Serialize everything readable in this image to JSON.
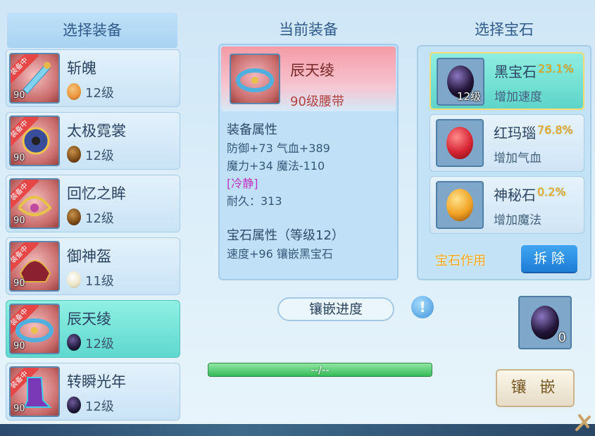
{
  "headers": {
    "left": "选择装备",
    "center": "当前装备",
    "right": "选择宝石"
  },
  "equipment": [
    {
      "equipped_tag": "装备中",
      "level": "90",
      "name": "斩魄",
      "gem_level": "12级",
      "gem_color": "#e8953a"
    },
    {
      "equipped_tag": "装备中",
      "level": "90",
      "name": "太极霓裳",
      "gem_level": "12级",
      "gem_color": "#7a4a16"
    },
    {
      "equipped_tag": "装备中",
      "level": "90",
      "name": "回忆之眸",
      "gem_level": "12级",
      "gem_color": "#7a4a16"
    },
    {
      "equipped_tag": "装备中",
      "level": "90",
      "name": "御神盔",
      "gem_level": "11级",
      "gem_color": "#e9e4c6"
    },
    {
      "equipped_tag": "装备中",
      "level": "90",
      "name": "辰天绫",
      "gem_level": "12级",
      "gem_color": "#1e1a3a"
    },
    {
      "equipped_tag": "装备中",
      "level": "90",
      "name": "转瞬光年",
      "gem_level": "12级",
      "gem_color": "#1e1a3a"
    }
  ],
  "selected_equipment_index": 4,
  "current": {
    "name": "辰天绫",
    "type": "90级腰带",
    "attr_title": "装备属性",
    "attr_line1": "防御+73 气血+389",
    "attr_line2": "魔力+34 魔法-110",
    "special": "[冷静]",
    "durability": "耐久：313",
    "gem_title": "宝石属性（等级12）",
    "gem_line": "速度+96 镶嵌黑宝石"
  },
  "gems": [
    {
      "name": "黑宝石",
      "rate": "23.1%",
      "desc": "增加速度",
      "count": "12级",
      "color": "#23163a",
      "selected": true
    },
    {
      "name": "红玛瑙",
      "rate": "76.8%",
      "desc": "增加气血",
      "count": "",
      "color": "#d62433",
      "selected": false
    },
    {
      "name": "神秘石",
      "rate": "0.2%",
      "desc": "增加魔法",
      "count": "",
      "color": "#f0a123",
      "selected": false
    }
  ],
  "gem_effect_label": "宝石作用",
  "remove_button": "拆 除",
  "inlay_progress_title": "镶嵌进度",
  "info_icon": "!",
  "progress_text": "--/--",
  "slot_count": "0",
  "inlay_button": "镶 嵌"
}
